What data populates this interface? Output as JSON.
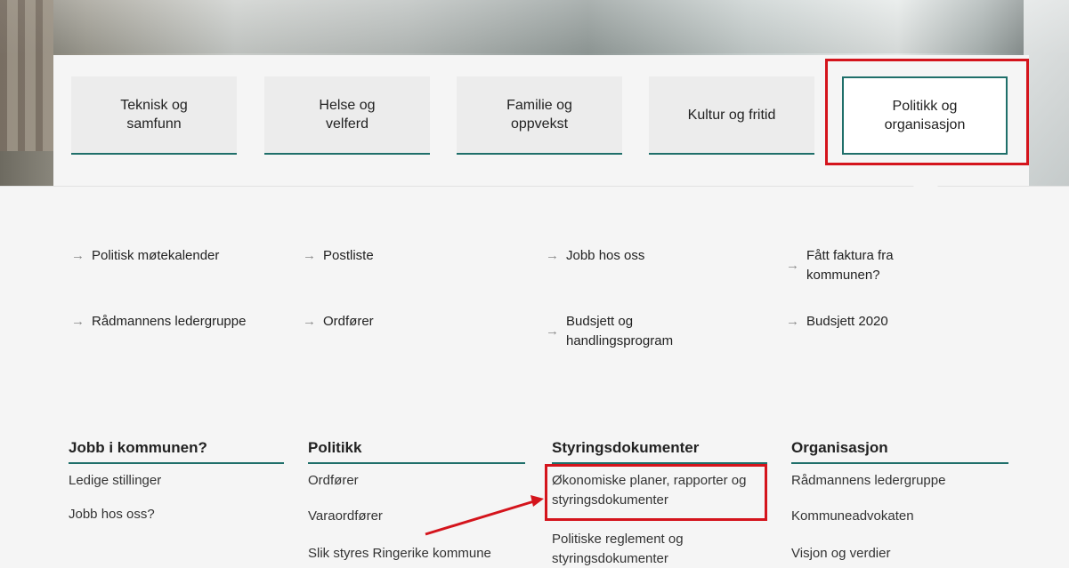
{
  "tiles": [
    "Teknisk og samfunn",
    "Helse og velferd",
    "Familie og oppvekst",
    "Kultur og fritid",
    "Politikk og organisasjon"
  ],
  "quick_links": {
    "c1": [
      "Politisk møtekalender",
      "Rådmannens ledergruppe"
    ],
    "c2": [
      "Postliste",
      "Ordfører"
    ],
    "c3": [
      "Jobb hos oss",
      "Budsjett og handlingsprogram"
    ],
    "c4": [
      "Fått faktura fra kommunen?",
      "Budsjett 2020"
    ]
  },
  "columns": {
    "jobb": {
      "heading": "Jobb i kommunen?",
      "links": [
        "Ledige stillinger",
        "Jobb hos oss?"
      ]
    },
    "politikk": {
      "heading": "Politikk",
      "links": [
        "Ordfører",
        "Varaordfører",
        "Slik styres Ringerike kommune"
      ]
    },
    "styring": {
      "heading": "Styringsdokumenter",
      "links": [
        "Økonomiske planer, rapporter og styringsdokumenter",
        "Politiske reglement og styringsdokumenter"
      ]
    },
    "org": {
      "heading": "Organisasjon",
      "links": [
        "Rådmannens ledergruppe",
        "Kommuneadvokaten",
        "Visjon og verdier"
      ]
    }
  },
  "colors": {
    "accent": "#1f6f6a",
    "annotation": "#d4141c"
  }
}
